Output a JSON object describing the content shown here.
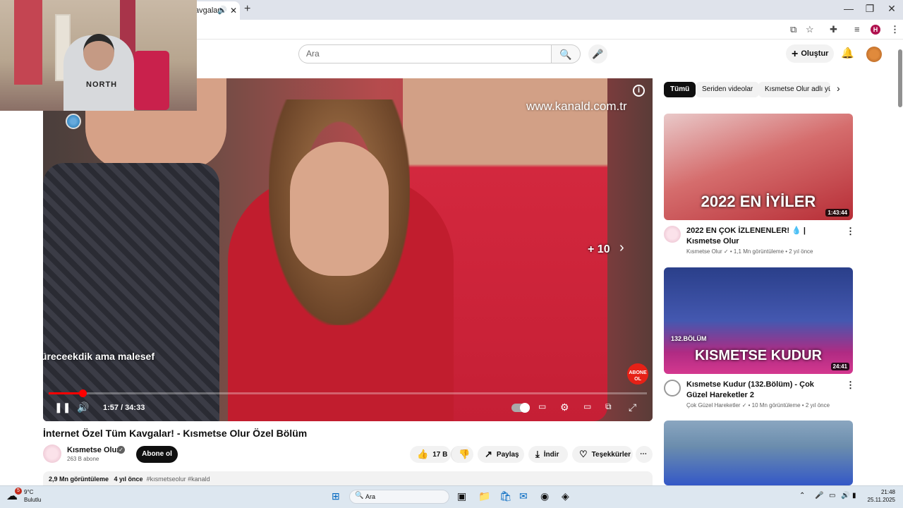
{
  "browser": {
    "tab_title": "avgalar",
    "audio_icon": "speaker-icon",
    "close_glyph": "✕",
    "newtab_glyph": "+",
    "profile_initial": "H",
    "window_min": "—",
    "window_max": "❐",
    "window_close": "✕"
  },
  "yt_header": {
    "search_placeholder": "Ara",
    "create_label": "Oluştur"
  },
  "player": {
    "watermark": "www.kanald.com.tr",
    "skip_label": "+ 10",
    "subtitle": "üreceekdik ama malesef",
    "time": "1:57 / 34:33",
    "progress_fraction": 0.0566,
    "subscribe_bug": "ABONE OL"
  },
  "video": {
    "title": "İnternet Özel Tüm Kavgalar! - Kısmetse Olur Özel Bölüm",
    "channel": "Kısmetse Olur",
    "subscribers": "263 B abone",
    "subscribe_label": "Abone ol",
    "likes": "17 B",
    "share_label": "Paylaş",
    "download_label": "İndir",
    "thanks_label": "Teşekkürler",
    "views": "2,9 Mn görüntüleme",
    "age": "4 yıl önce",
    "tags": "#kısmetseolur #kanald"
  },
  "chips": [
    "Tümü",
    "Seriden videolar",
    "Kısmetse Olur adlı yü"
  ],
  "recommendations": [
    {
      "thumb_text": "2022 EN İYİLER",
      "duration": "1:43:44",
      "title": "2022 EN ÇOK İZLENENLER! 💧 | Kısmetse Olur",
      "channel": "Kısmetse Olur",
      "meta": "1,1 Mn görüntüleme • 2 yıl önce"
    },
    {
      "thumb_text": "KISMETSE KUDUR",
      "thumb_badge": "132.BÖLÜM",
      "duration": "24:41",
      "title": "Kısmetse Kudur (132.Bölüm) - Çok Güzel Hareketler 2",
      "channel": "Çok Güzel Hareketler",
      "meta": "10 Mn görüntüleme • 2 yıl önce"
    }
  ],
  "taskbar": {
    "temp": "9°C",
    "weather": "Bulutlu",
    "notif_count": "5",
    "search_label": "Ara",
    "time": "21:48",
    "date": "25.11.2025"
  },
  "webcam_shirt_text": "NORTH"
}
